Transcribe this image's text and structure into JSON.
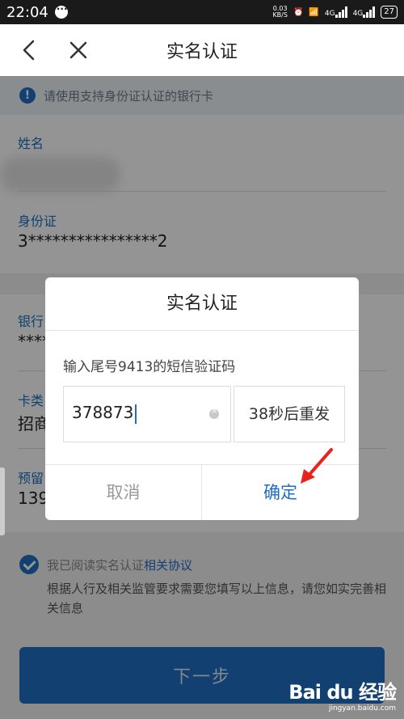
{
  "status_bar": {
    "time": "22:04",
    "net_speed_value": "0.03",
    "net_speed_unit": "KB/S",
    "network_1": "4G",
    "network_2": "4G",
    "battery": "27"
  },
  "navbar": {
    "title": "实名认证"
  },
  "notice": {
    "text": "请使用支持身份证认证的银行卡"
  },
  "form": {
    "name_label": "姓名",
    "id_label": "身份证",
    "id_value": "3****************2",
    "bank_label_partial": "银行",
    "bank_value_partial": "****",
    "card_type_label_partial": "卡类",
    "card_type_value_partial": "招商",
    "phone_label_partial": "预留",
    "phone_value_partial": "139"
  },
  "agreement": {
    "prefix": "我已阅读实名认证",
    "link": "相关协议",
    "note": "根据人行及相关监管要求需要您填写以上信息，请您如实完善相关信息"
  },
  "next_button": "下一步",
  "dialog": {
    "title": "实名认证",
    "prompt": "输入尾号9413的短信验证码",
    "code_value": "378873",
    "resend": "38秒后重发",
    "cancel": "取消",
    "confirm": "确定"
  },
  "watermark": {
    "logo": "Bai du 经验",
    "url": "jingyan.baidu.com"
  },
  "colors": {
    "accent": "#1f6ec2",
    "arrow": "#e8231e"
  }
}
